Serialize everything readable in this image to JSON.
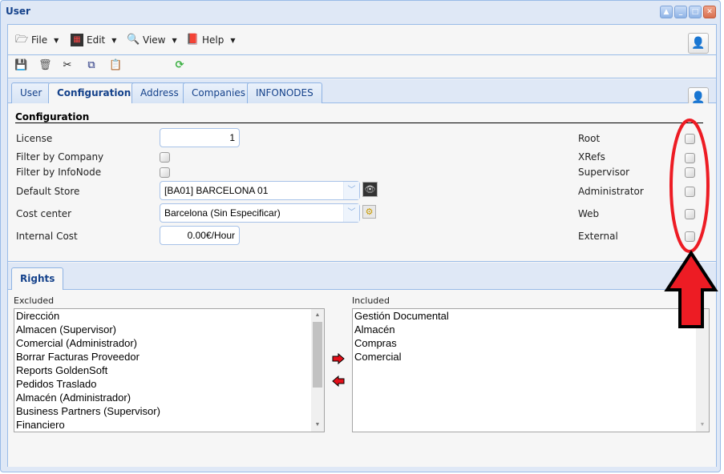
{
  "window": {
    "title": "User",
    "tools": [
      "collapse-icon",
      "minimize-icon",
      "maximize-icon",
      "close-icon"
    ]
  },
  "menubar": {
    "items": [
      {
        "label": "File",
        "icon": "file-icon"
      },
      {
        "label": "Edit",
        "icon": "edit-icon"
      },
      {
        "label": "View",
        "icon": "view-icon"
      },
      {
        "label": "Help",
        "icon": "help-icon"
      }
    ]
  },
  "toolbar": {
    "buttons": [
      "save-icon",
      "delete-icon",
      "cut-icon",
      "copy-icon",
      "paste-icon",
      "refresh-icon"
    ]
  },
  "tabs": [
    {
      "label": "User",
      "active": false
    },
    {
      "label": "Configuration",
      "active": true
    },
    {
      "label": "Address",
      "active": false
    },
    {
      "label": "Companies",
      "active": false
    },
    {
      "label": "INFONODES",
      "active": false
    }
  ],
  "configuration": {
    "section_title": "Configuration",
    "license": {
      "label": "License",
      "value": "1"
    },
    "filter_by_company": {
      "label": "Filter by Company",
      "checked": false
    },
    "filter_by_infonode": {
      "label": "Filter by InfoNode",
      "checked": false
    },
    "default_store": {
      "label": "Default Store",
      "value": "[BA01] BARCELONA 01"
    },
    "cost_center": {
      "label": "Cost center",
      "value": "Barcelona  (Sin Especificar)"
    },
    "internal_cost": {
      "label": "Internal Cost",
      "value": "0.00€/Hour"
    },
    "flags": [
      {
        "label": "Root",
        "checked": false
      },
      {
        "label": "XRefs",
        "checked": false
      },
      {
        "label": "Supervisor",
        "checked": false
      },
      {
        "label": "Administrator",
        "checked": false
      },
      {
        "label": "Web",
        "checked": false
      },
      {
        "label": "External",
        "checked": false
      }
    ]
  },
  "rights": {
    "tab_label": "Rights",
    "excluded_label": "Excluded",
    "included_label": "Included",
    "excluded": [
      "Dirección",
      "Almacen (Supervisor)",
      "Comercial (Administrador)",
      "Borrar Facturas Proveedor",
      "Reports GoldenSoft",
      "Pedidos Traslado",
      "Almacén (Administrador)",
      "Business Partners (Supervisor)",
      "Financiero"
    ],
    "included": [
      "Gestión Documental",
      "Almacén",
      "Compras",
      "Comercial"
    ]
  },
  "colors": {
    "accent": "#15428b",
    "frame": "#99bbe8",
    "annotation": "#ed1c24"
  }
}
